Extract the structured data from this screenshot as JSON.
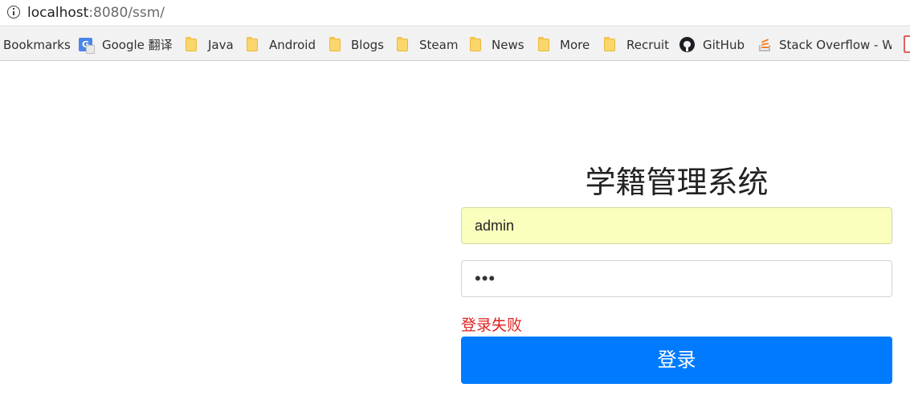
{
  "browser": {
    "url_host": "localhost",
    "url_rest": ":8080/ssm/",
    "bookmarks": [
      {
        "label": "Bookmarks",
        "icon": "none"
      },
      {
        "label": "Google 翻译",
        "icon": "google-translate-icon"
      },
      {
        "label": "Java",
        "icon": "folder-icon"
      },
      {
        "label": "Android",
        "icon": "folder-icon"
      },
      {
        "label": "Blogs",
        "icon": "folder-icon"
      },
      {
        "label": "Steam",
        "icon": "folder-icon"
      },
      {
        "label": "News",
        "icon": "folder-icon"
      },
      {
        "label": "More",
        "icon": "folder-icon"
      },
      {
        "label": "Recruit",
        "icon": "folder-icon"
      },
      {
        "label": "GitHub",
        "icon": "github-icon"
      },
      {
        "label": "Stack Overflow - Wh",
        "icon": "stackoverflow-icon"
      }
    ]
  },
  "login": {
    "title": "学籍管理系统",
    "username_value": "admin",
    "password_masked": "•••",
    "error_message": "登录失败",
    "submit_label": "登录"
  },
  "colors": {
    "primary_button": "#007bff",
    "error_text": "#e02020",
    "autofill_background": "#faffbd"
  }
}
